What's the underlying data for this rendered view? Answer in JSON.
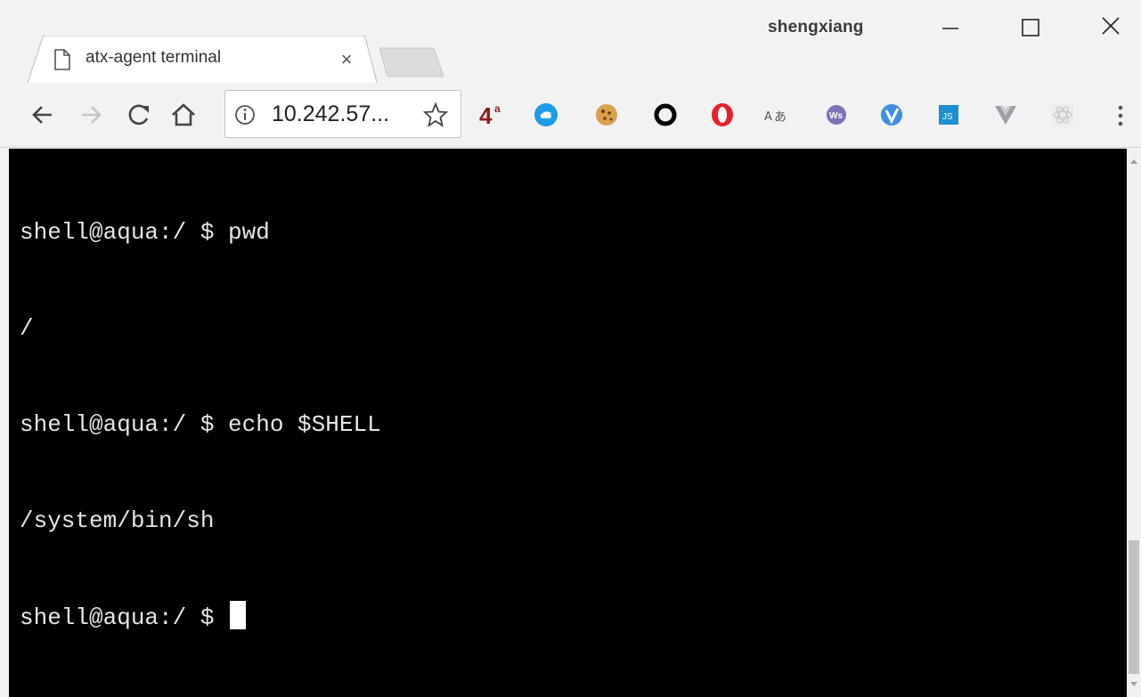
{
  "window": {
    "profile_name": "shengxiang",
    "minimize_icon": "minimize-icon",
    "maximize_icon": "maximize-icon",
    "close_icon": "close-icon"
  },
  "tab": {
    "title": "atx-agent terminal",
    "close_label": "×",
    "icon": "page-icon"
  },
  "toolbar": {
    "back_icon": "arrow-left-icon",
    "forward_icon": "arrow-right-icon",
    "reload_icon": "reload-icon",
    "home_icon": "home-icon",
    "url": "10.242.57...",
    "info_icon": "info-icon",
    "bookmark_icon": "star-icon",
    "extensions": [
      {
        "name": "4a-extension",
        "label": "4",
        "sup": "a",
        "color": "#8b1a1a"
      },
      {
        "name": "chat-extension",
        "color": "#1e9be9"
      },
      {
        "name": "cookie-extension",
        "color": "#d9a24a"
      },
      {
        "name": "ring-extension",
        "color": "#000000"
      },
      {
        "name": "opera-extension",
        "color": "#e8202a"
      },
      {
        "name": "translate-extension",
        "label": "Aあ",
        "color": "#555555"
      },
      {
        "name": "ws-extension",
        "label": "Ws",
        "color": "#7a74b8"
      },
      {
        "name": "vimium-extension",
        "color": "#3f8fe0"
      },
      {
        "name": "json-extension",
        "label": "JS",
        "color": "#1b8fcf"
      },
      {
        "name": "vue-extension",
        "color": "#9aa0a6"
      },
      {
        "name": "react-extension",
        "color": "#c8c8c8"
      }
    ],
    "menu_icon": "more-vert-icon"
  },
  "terminal": {
    "lines": [
      "shell@aqua:/ $ pwd",
      "/",
      "shell@aqua:/ $ echo $SHELL",
      "/system/bin/sh",
      "shell@aqua:/ $ "
    ]
  }
}
